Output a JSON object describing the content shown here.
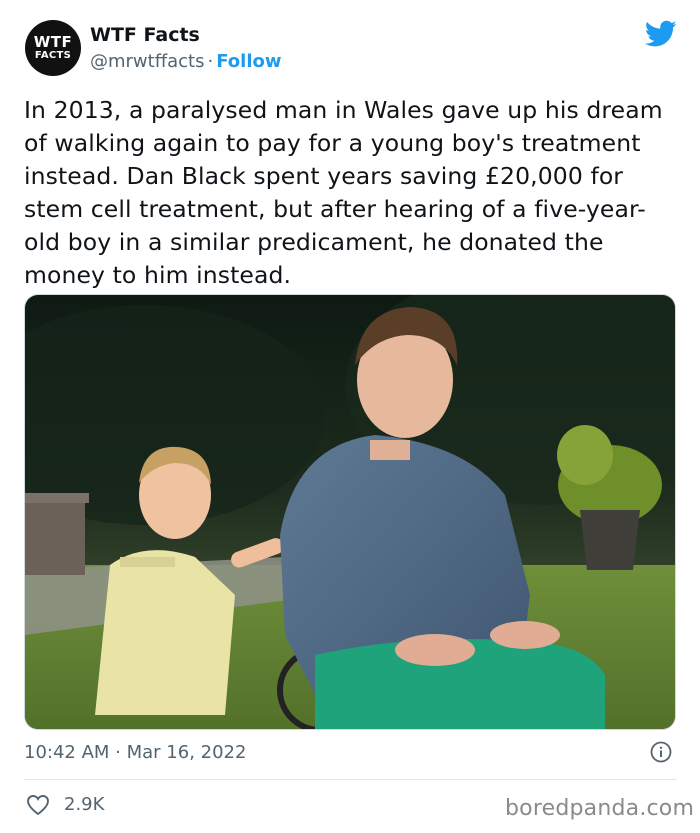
{
  "author": {
    "name": "WTF Facts",
    "handle": "@mrwtffacts",
    "separator": "·",
    "follow_label": "Follow",
    "avatar_line1": "WTF",
    "avatar_line2": "FACTS"
  },
  "tweet": {
    "text": "In 2013, a paralysed man in Wales gave up his dream of walking again to pay for a young boy's treatment instead. Dan Black spent years saving £20,000 for stem cell treatment, but after hearing of a five-year-old boy in a similar predicament, he donated the money to him instead.",
    "timestamp": "10:42 AM · Mar 16, 2022",
    "likes": "2.9K"
  },
  "icons": {
    "brand": "twitter-bird-icon",
    "info": "info-icon",
    "like": "heart-icon"
  },
  "colors": {
    "accent": "#1d9bf0",
    "muted": "#536471",
    "text": "#0f1419"
  },
  "watermark": "boredpanda.com"
}
